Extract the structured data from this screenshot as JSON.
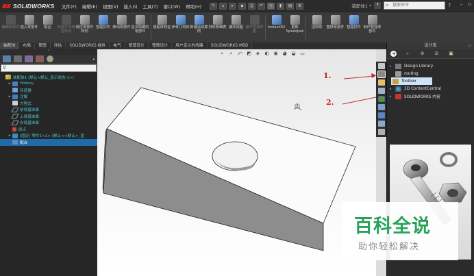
{
  "app": {
    "brand": "SOLIDWORKS"
  },
  "menu": [
    "文件(F)",
    "编辑(E)",
    "视图(V)",
    "插入(I)",
    "工具(T)",
    "窗口(W)",
    "帮助(H)"
  ],
  "window_title": "装配体1 *",
  "search": {
    "placeholder": "搜索命令"
  },
  "toolbar": [
    {
      "label": "编辑零部件",
      "enabled": false
    },
    {
      "label": "插入零部件",
      "enabled": true
    },
    {
      "label": "配合",
      "enabled": true
    },
    {
      "label": "零部件的线性阵列",
      "enabled": false
    },
    {
      "label": "线性零部件阵列",
      "enabled": true
    },
    {
      "label": "智能扣件",
      "enabled": true
    },
    {
      "label": "移动零部件",
      "enabled": true
    },
    {
      "label": "显示隐藏的零部件",
      "enabled": true
    },
    {
      "label": "装配体特征",
      "enabled": true
    },
    {
      "label": "参考几何体",
      "enabled": true
    },
    {
      "label": "新建运动算例",
      "enabled": true
    },
    {
      "label": "材料明细表",
      "enabled": true
    },
    {
      "label": "爆炸视图",
      "enabled": true
    },
    {
      "label": "爆炸直线草图",
      "enabled": false
    },
    {
      "label": "Instant3D",
      "enabled": true
    },
    {
      "label": "更新Speedpak",
      "enabled": true
    },
    {
      "label": "拍快照",
      "enabled": true
    },
    {
      "label": "替换零部件",
      "enabled": true
    },
    {
      "label": "智能扣件",
      "enabled": true
    },
    {
      "label": "制作智能零部件",
      "enabled": true
    }
  ],
  "cm_tabs": [
    "装配体",
    "布局",
    "草图",
    "评估",
    "SOLIDWORKS 插件",
    "电气",
    "管道设计",
    "管筒设计",
    "用户定义的线路",
    "SOLIDWORKS MBD"
  ],
  "feature_tree": [
    {
      "label": "装配体1 (默认<默认_显示状态-1>)",
      "icon": "assembly-icon",
      "exp": "",
      "sel": false
    },
    {
      "label": "History",
      "icon": "history-icon",
      "exp": "▸",
      "sel": false
    },
    {
      "label": "传感器",
      "icon": "sensor-icon",
      "exp": "",
      "sel": false
    },
    {
      "label": "注解",
      "icon": "annotation-icon",
      "exp": "▸",
      "sel": false
    },
    {
      "label": "方程式",
      "icon": "equation-icon",
      "exp": "",
      "sel": false
    },
    {
      "label": "前视基准面",
      "icon": "plane-icon",
      "exp": "",
      "sel": false
    },
    {
      "label": "上视基准面",
      "icon": "plane-icon",
      "exp": "",
      "sel": false
    },
    {
      "label": "右视基准面",
      "icon": "plane-icon",
      "exp": "",
      "sel": false
    },
    {
      "label": "原点",
      "icon": "origin-icon",
      "exp": "",
      "sel": false
    },
    {
      "label": "(固定) 零件1<1> (默认<<默认>_显",
      "icon": "part-icon",
      "exp": "▸",
      "sel": false
    },
    {
      "label": "配合",
      "icon": "mates-icon",
      "exp": "",
      "sel": true
    }
  ],
  "design_library": {
    "title": "设计库",
    "items": [
      {
        "label": "Design Library",
        "icon": "design-library-icon",
        "exp": "▸",
        "sel": false
      },
      {
        "label": "routing",
        "icon": "routing-icon",
        "exp": "",
        "sel": false
      },
      {
        "label": "Toolbox",
        "icon": "toolbox-icon",
        "exp": "",
        "sel": true
      },
      {
        "label": "3D ContentCentral",
        "icon": "3d-content-central-icon",
        "exp": "▸",
        "sel": false
      },
      {
        "label": "SOLIDWORKS 内容",
        "icon": "solidworks-content-icon",
        "exp": "▸",
        "sel": false
      }
    ]
  },
  "annotations": [
    "1.",
    "2."
  ],
  "watermark": {
    "main": "百科全说",
    "sub": "助你轻松解决"
  },
  "colors": {
    "annotation": "#c0271e",
    "tree_text": "#46c8d0",
    "selection": "#1f6aa8",
    "watermark": "#29a35c"
  }
}
